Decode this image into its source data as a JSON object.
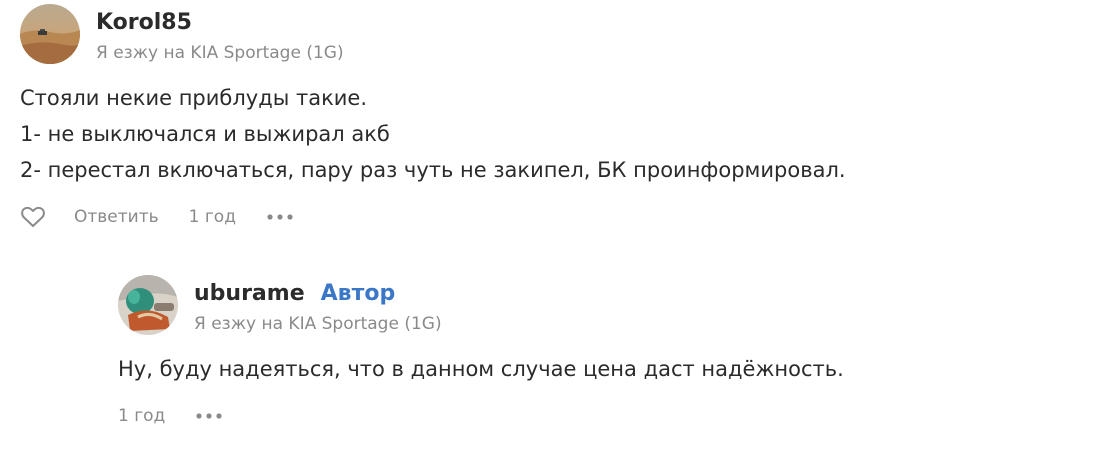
{
  "comment": {
    "username": "Korol85",
    "car": "Я езжу на KIA Sportage (1G)",
    "lines": [
      "Стояли некие приблуды такие.",
      "1- не выключался и выжирал акб",
      "2- перестал включаться, пару раз чуть не закипел, БК проинформировал."
    ],
    "reply_label": "Ответить",
    "time": "1 год"
  },
  "reply": {
    "username": "uburame",
    "badge": "Автор",
    "car": "Я езжу на KIA Sportage (1G)",
    "lines": [
      "Ну, буду надеяться, что в данном случае цена даст надёжность."
    ],
    "time": "1 год"
  },
  "colors": {
    "text": "#2b2b2b",
    "muted": "#8a8a8a",
    "author_badge": "#3a78c7"
  },
  "icons": {
    "like": "heart-outline-icon",
    "more": "ellipsis-icon"
  }
}
